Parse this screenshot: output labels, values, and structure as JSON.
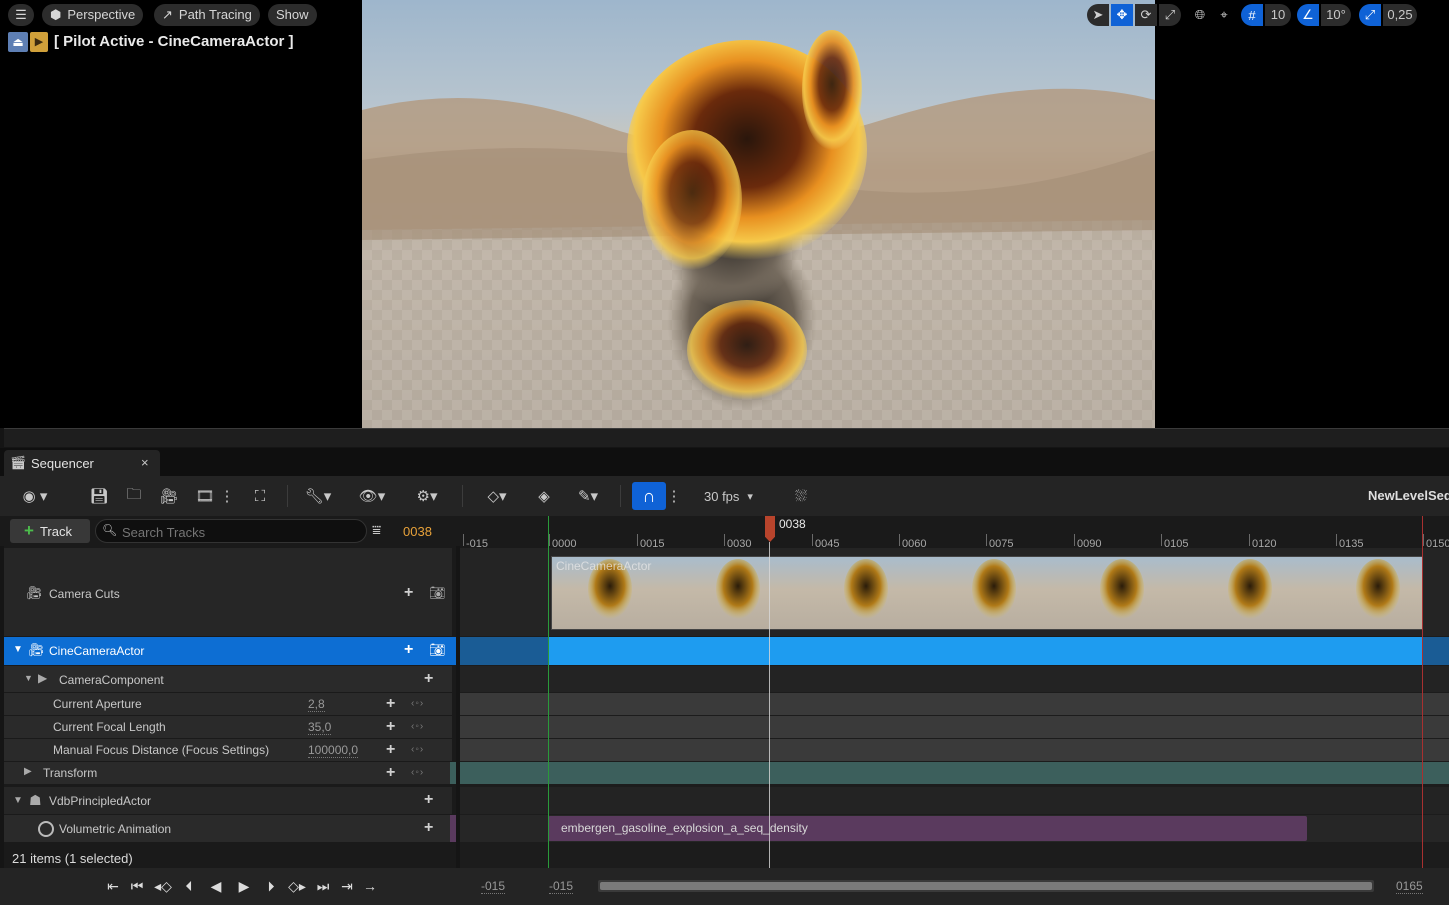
{
  "viewport": {
    "menu_icon": "hamburger-icon",
    "perspective_label": "Perspective",
    "path_tracing_label": "Path Tracing",
    "show_label": "Show",
    "pilot_label": "[ Pilot Active - CineCameraActor ]",
    "grid_snap_value": "10",
    "rotation_snap_value": "10°",
    "scale_snap_value": "0,25"
  },
  "sequencer": {
    "tab_label": "Sequencer",
    "fps_label": "30 fps",
    "sequence_name": "NewLevelSeq",
    "add_track_label": "Track",
    "search_placeholder": "Search Tracks",
    "current_frame": "0038",
    "playhead_label": "0038",
    "items_status": "21 items (1 selected)",
    "tracks": {
      "camera_cuts": "Camera Cuts",
      "cine_camera_actor": "CineCameraActor",
      "camera_component": "CameraComponent",
      "current_aperture": "Current Aperture",
      "current_aperture_value": "2,8",
      "current_focal_length": "Current Focal Length",
      "current_focal_length_value": "35,0",
      "manual_focus_distance": "Manual Focus Distance (Focus Settings)",
      "manual_focus_distance_value": "100000,0",
      "transform": "Transform",
      "vdb_actor": "VdbPrincipledActor",
      "volumetric_animation": "Volumetric Animation"
    },
    "camera_cut_clip_label": "CineCameraActor",
    "volumetric_clip_label": "embergen_gasoline_explosion_a_seq_density",
    "ruler_ticks": [
      "-015",
      "0000",
      "0015",
      "0030",
      "0045",
      "0060",
      "0075",
      "0090",
      "0105",
      "0120",
      "0135",
      "0150"
    ],
    "bottom": {
      "view_start": "-015",
      "working_start": "-015",
      "view_end": "0165"
    }
  },
  "colors": {
    "accent_blue": "#0f62d6",
    "selected_row": "#0d6ed3",
    "camera_bar": "#1e9cf0",
    "transform_bar": "#3c5f5c",
    "volumetric_clip": "#5a3a5e",
    "playhead": "#b8442c",
    "orange_frame": "#e8a23a"
  }
}
